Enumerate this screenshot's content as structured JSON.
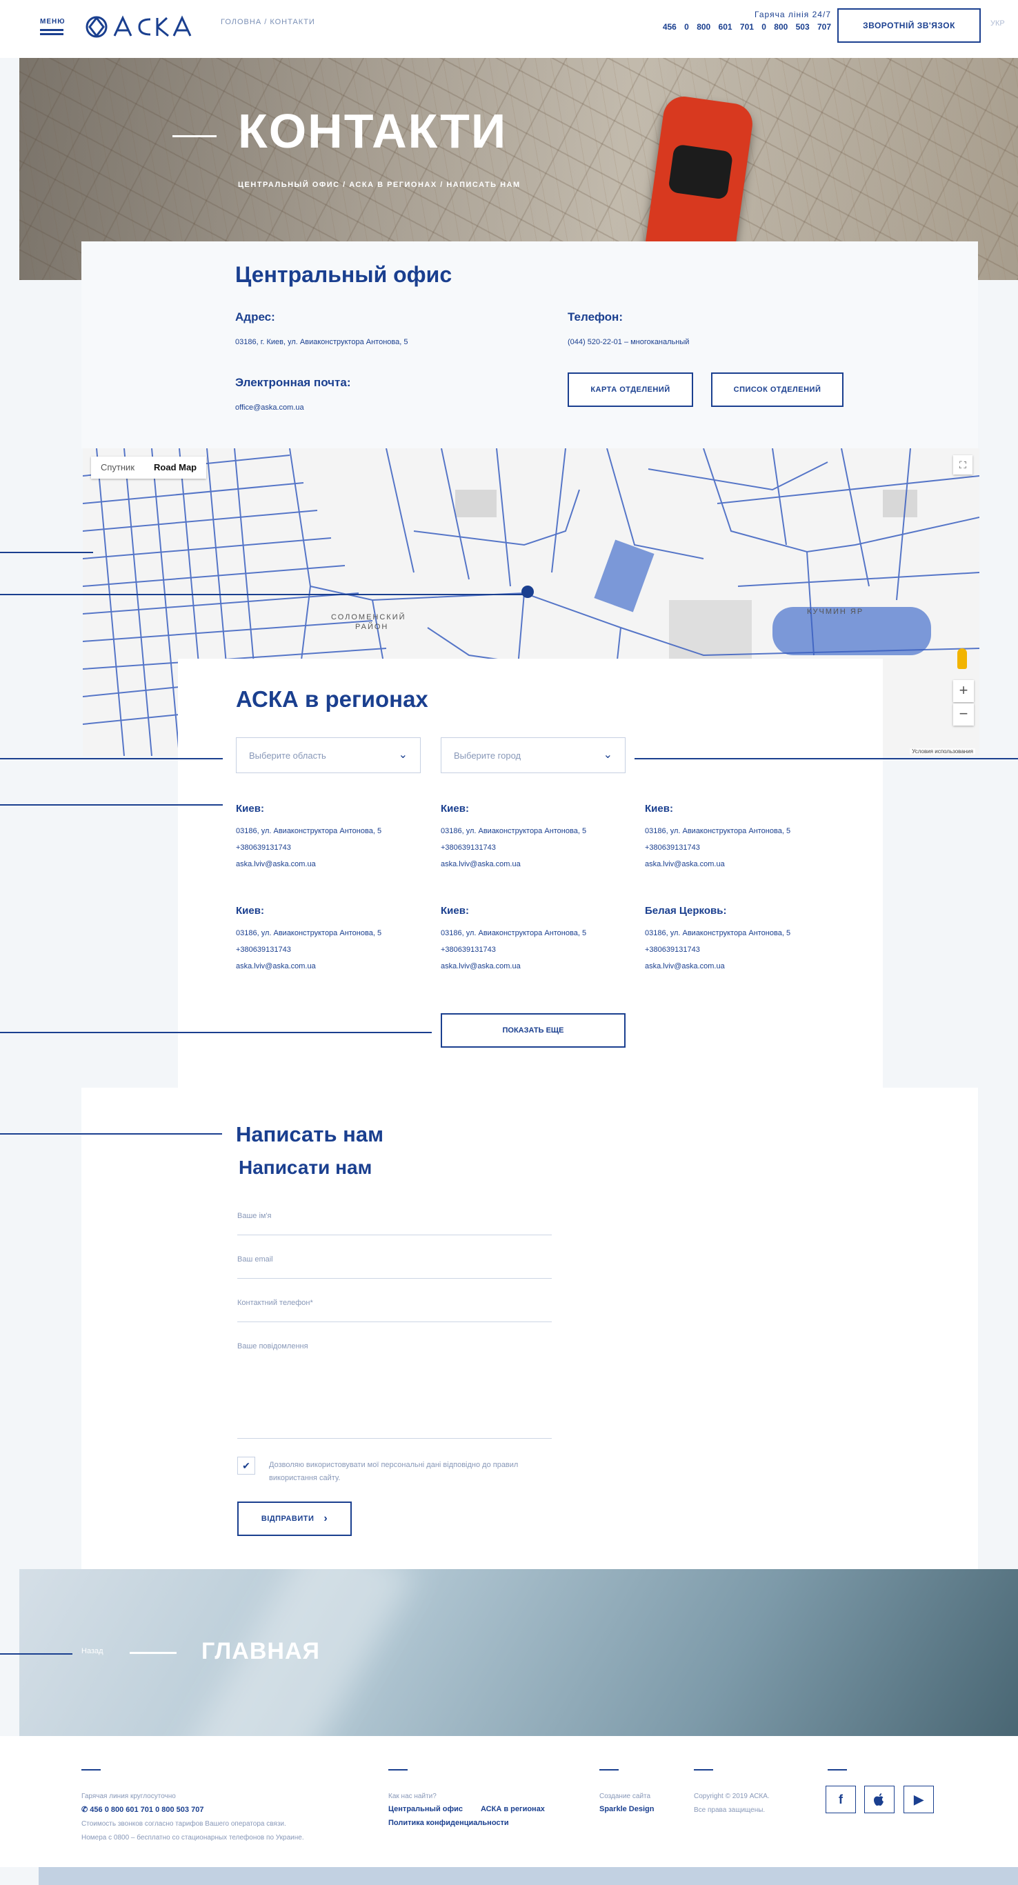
{
  "header": {
    "menu_label": "МЕНЮ",
    "logo_text": "АСКА",
    "breadcrumb": "ГОЛОВНА  /  КОНТАКТИ",
    "hotline_label": "Гаряча лінія 24/7",
    "hotline_numbers": "456  0 800 601 701  0 800 503 707",
    "callback_button": "ЗВОРОТНІЙ ЗВ'ЯЗОК",
    "language": "УКР"
  },
  "hero": {
    "title": "КОНТАКТИ",
    "breadcrumb": "ЦЕНТРАЛЬНЫЙ ОФИС  /  АСКА В РЕГИОНАХ  /  НАПИСАТЬ НАМ"
  },
  "office": {
    "title": "Центральный офис",
    "address_label": "Адрес:",
    "address_value": "03186, г. Киев, ул. Авиаконструктора Антонова, 5",
    "phone_label": "Телефон:",
    "phone_value": "(044) 520-22-01 – многоканальный",
    "email_label": "Электронная почта:",
    "email_value": "office@aska.com.ua",
    "map_button": "КАРТА ОТДЕЛЕНИЙ",
    "list_button": "СПИСОК ОТДЕЛЕНИЙ"
  },
  "map": {
    "satellite_label": "Спутник",
    "roadmap_label": "Road Map",
    "district_label": "СОЛОМЕНСКИЙ РАЙОН",
    "district2_label": "КУЧМИН ЯР",
    "zoom_in": "+",
    "zoom_out": "−",
    "attribution": "Условия использования"
  },
  "regions": {
    "title": "АСКА в регионах",
    "select_region_placeholder": "Выберите область",
    "select_city_placeholder": "Выберите город",
    "offices": [
      {
        "city": "Киев:",
        "address": "03186, ул. Авиаконструктора Антонова, 5",
        "phone": "+380639131743",
        "email": "aska.lviv@aska.com.ua"
      },
      {
        "city": "Киев:",
        "address": "03186, ул. Авиаконструктора Антонова, 5",
        "phone": "+380639131743",
        "email": "aska.lviv@aska.com.ua"
      },
      {
        "city": "Киев:",
        "address": "03186, ул. Авиаконструктора Антонова, 5",
        "phone": "+380639131743",
        "email": "aska.lviv@aska.com.ua"
      },
      {
        "city": "Киев:",
        "address": "03186, ул. Авиаконструктора Антонова, 5",
        "phone": "+380639131743",
        "email": "aska.lviv@aska.com.ua"
      },
      {
        "city": "Киев:",
        "address": "03186, ул. Авиаконструктора Антонова, 5",
        "phone": "+380639131743",
        "email": "aska.lviv@aska.com.ua"
      },
      {
        "city": "Белая Церковь:",
        "address": "03186, ул. Авиаконструктора Антонова, 5",
        "phone": "+380639131743",
        "email": "aska.lviv@aska.com.ua"
      }
    ],
    "show_more_button": "ПОКАЗАТЬ ЕЩЕ"
  },
  "form": {
    "title_ru": "Написать нам",
    "title_ua": "Написати нам",
    "name_placeholder": "Ваше ім'я",
    "email_placeholder": "Ваш email",
    "phone_placeholder": "Контактний телефон*",
    "message_placeholder": "Ваше повідомлення",
    "consent_text": "Дозволяю використовувати мої персональні дані відповідно до правил використання сайту.",
    "submit_button": "ВІДПРАВИТИ"
  },
  "back_banner": {
    "small_label": "Назад",
    "title": "ГЛАВНАЯ"
  },
  "footer": {
    "hotline_label": "Гарячая линия круглосуточно",
    "hotline_numbers": "456   0 800 601 701   0 800 503 707",
    "hotline_note_1": "Стоимость звонков согласно тарифов Вашего оператора связи.",
    "hotline_note_2": "Номера с 0800 – бесплатно со стационарных телефонов по Украине.",
    "find_label": "Как нас найти?",
    "link_central": "Центральный офис",
    "link_regions": "АСКА в регионах",
    "link_privacy": "Политика конфиденциальности",
    "created_label": "Создание сайта",
    "created_by": "Sparkle Design",
    "copyright": "Copyright © 2019 АСКА.",
    "rights": "Все права защищены.",
    "social_facebook": "f",
    "social_apple": "",
    "social_play": "▶"
  },
  "colors": {
    "brand": "#1a3f8f",
    "muted": "#8898b8",
    "background": "#f3f6f9"
  }
}
